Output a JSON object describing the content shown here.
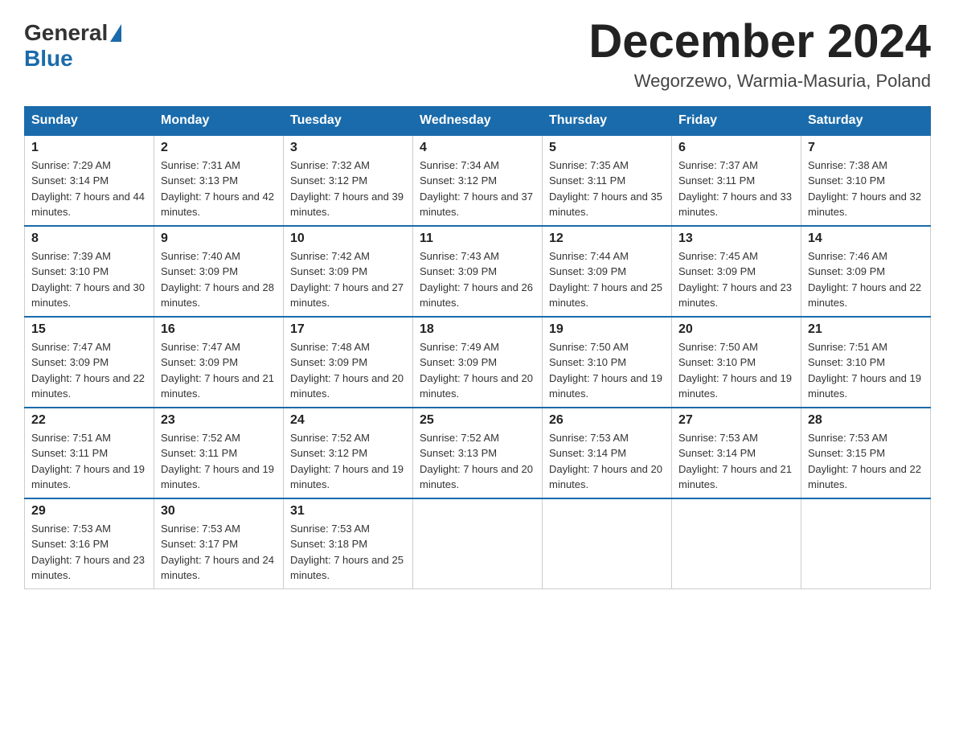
{
  "logo": {
    "general": "General",
    "blue": "Blue"
  },
  "title": "December 2024",
  "location": "Wegorzewo, Warmia-Masuria, Poland",
  "headers": [
    "Sunday",
    "Monday",
    "Tuesday",
    "Wednesday",
    "Thursday",
    "Friday",
    "Saturday"
  ],
  "weeks": [
    [
      {
        "day": "1",
        "sunrise": "7:29 AM",
        "sunset": "3:14 PM",
        "daylight": "7 hours and 44 minutes."
      },
      {
        "day": "2",
        "sunrise": "7:31 AM",
        "sunset": "3:13 PM",
        "daylight": "7 hours and 42 minutes."
      },
      {
        "day": "3",
        "sunrise": "7:32 AM",
        "sunset": "3:12 PM",
        "daylight": "7 hours and 39 minutes."
      },
      {
        "day": "4",
        "sunrise": "7:34 AM",
        "sunset": "3:12 PM",
        "daylight": "7 hours and 37 minutes."
      },
      {
        "day": "5",
        "sunrise": "7:35 AM",
        "sunset": "3:11 PM",
        "daylight": "7 hours and 35 minutes."
      },
      {
        "day": "6",
        "sunrise": "7:37 AM",
        "sunset": "3:11 PM",
        "daylight": "7 hours and 33 minutes."
      },
      {
        "day": "7",
        "sunrise": "7:38 AM",
        "sunset": "3:10 PM",
        "daylight": "7 hours and 32 minutes."
      }
    ],
    [
      {
        "day": "8",
        "sunrise": "7:39 AM",
        "sunset": "3:10 PM",
        "daylight": "7 hours and 30 minutes."
      },
      {
        "day": "9",
        "sunrise": "7:40 AM",
        "sunset": "3:09 PM",
        "daylight": "7 hours and 28 minutes."
      },
      {
        "day": "10",
        "sunrise": "7:42 AM",
        "sunset": "3:09 PM",
        "daylight": "7 hours and 27 minutes."
      },
      {
        "day": "11",
        "sunrise": "7:43 AM",
        "sunset": "3:09 PM",
        "daylight": "7 hours and 26 minutes."
      },
      {
        "day": "12",
        "sunrise": "7:44 AM",
        "sunset": "3:09 PM",
        "daylight": "7 hours and 25 minutes."
      },
      {
        "day": "13",
        "sunrise": "7:45 AM",
        "sunset": "3:09 PM",
        "daylight": "7 hours and 23 minutes."
      },
      {
        "day": "14",
        "sunrise": "7:46 AM",
        "sunset": "3:09 PM",
        "daylight": "7 hours and 22 minutes."
      }
    ],
    [
      {
        "day": "15",
        "sunrise": "7:47 AM",
        "sunset": "3:09 PM",
        "daylight": "7 hours and 22 minutes."
      },
      {
        "day": "16",
        "sunrise": "7:47 AM",
        "sunset": "3:09 PM",
        "daylight": "7 hours and 21 minutes."
      },
      {
        "day": "17",
        "sunrise": "7:48 AM",
        "sunset": "3:09 PM",
        "daylight": "7 hours and 20 minutes."
      },
      {
        "day": "18",
        "sunrise": "7:49 AM",
        "sunset": "3:09 PM",
        "daylight": "7 hours and 20 minutes."
      },
      {
        "day": "19",
        "sunrise": "7:50 AM",
        "sunset": "3:10 PM",
        "daylight": "7 hours and 19 minutes."
      },
      {
        "day": "20",
        "sunrise": "7:50 AM",
        "sunset": "3:10 PM",
        "daylight": "7 hours and 19 minutes."
      },
      {
        "day": "21",
        "sunrise": "7:51 AM",
        "sunset": "3:10 PM",
        "daylight": "7 hours and 19 minutes."
      }
    ],
    [
      {
        "day": "22",
        "sunrise": "7:51 AM",
        "sunset": "3:11 PM",
        "daylight": "7 hours and 19 minutes."
      },
      {
        "day": "23",
        "sunrise": "7:52 AM",
        "sunset": "3:11 PM",
        "daylight": "7 hours and 19 minutes."
      },
      {
        "day": "24",
        "sunrise": "7:52 AM",
        "sunset": "3:12 PM",
        "daylight": "7 hours and 19 minutes."
      },
      {
        "day": "25",
        "sunrise": "7:52 AM",
        "sunset": "3:13 PM",
        "daylight": "7 hours and 20 minutes."
      },
      {
        "day": "26",
        "sunrise": "7:53 AM",
        "sunset": "3:14 PM",
        "daylight": "7 hours and 20 minutes."
      },
      {
        "day": "27",
        "sunrise": "7:53 AM",
        "sunset": "3:14 PM",
        "daylight": "7 hours and 21 minutes."
      },
      {
        "day": "28",
        "sunrise": "7:53 AM",
        "sunset": "3:15 PM",
        "daylight": "7 hours and 22 minutes."
      }
    ],
    [
      {
        "day": "29",
        "sunrise": "7:53 AM",
        "sunset": "3:16 PM",
        "daylight": "7 hours and 23 minutes."
      },
      {
        "day": "30",
        "sunrise": "7:53 AM",
        "sunset": "3:17 PM",
        "daylight": "7 hours and 24 minutes."
      },
      {
        "day": "31",
        "sunrise": "7:53 AM",
        "sunset": "3:18 PM",
        "daylight": "7 hours and 25 minutes."
      },
      null,
      null,
      null,
      null
    ]
  ]
}
